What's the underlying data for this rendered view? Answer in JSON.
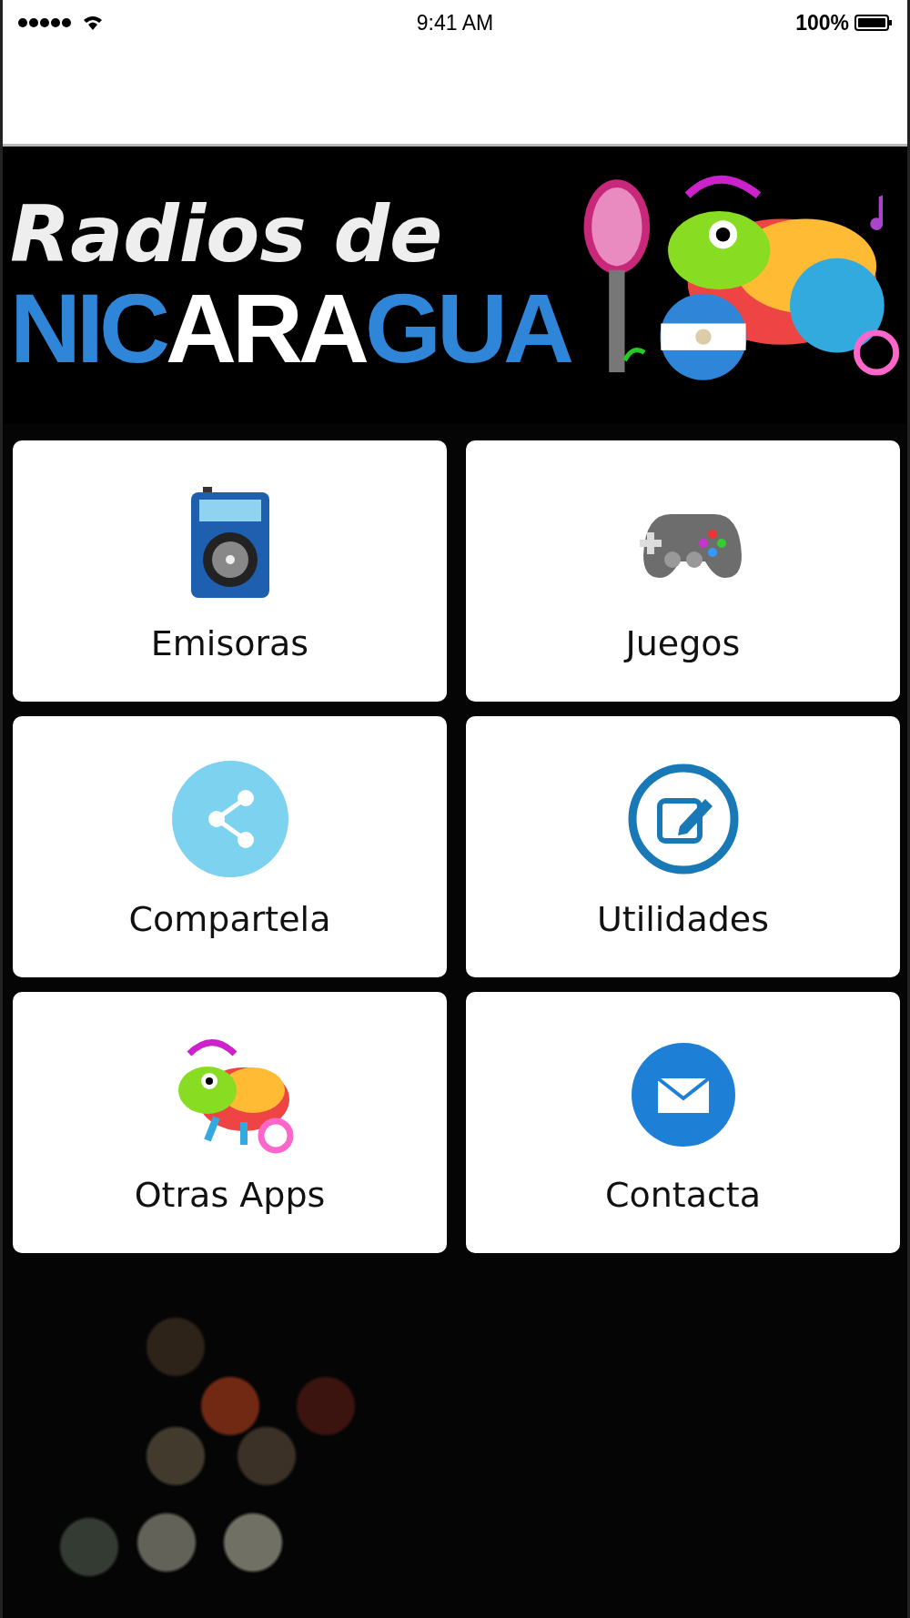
{
  "status_bar": {
    "time": "9:41 AM",
    "battery": "100%"
  },
  "banner": {
    "line1": "Radios de",
    "line2": [
      {
        "text": "NIC",
        "color": "#2f86d8"
      },
      {
        "text": "ARA",
        "color": "#ffffff"
      },
      {
        "text": "GUA",
        "color": "#2f86d8"
      }
    ]
  },
  "menu": [
    {
      "label": "Emisoras",
      "kind": "radio"
    },
    {
      "label": "Juegos",
      "kind": "gamepad"
    },
    {
      "label": "Compartela",
      "kind": "share"
    },
    {
      "label": "Utilidades",
      "kind": "edit"
    },
    {
      "label": "Otras Apps",
      "kind": "chameleon"
    },
    {
      "label": "Contacta",
      "kind": "mail"
    }
  ]
}
